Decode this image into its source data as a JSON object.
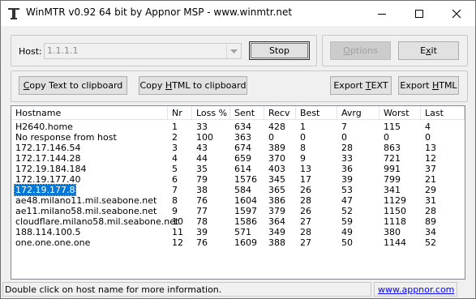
{
  "window": {
    "title": "WinMTR v0.92 64 bit by Appnor MSP - www.winmtr.net"
  },
  "host": {
    "label": "Host:",
    "value": "1.1.1.1"
  },
  "buttons": {
    "stop": "Stop",
    "options": "Options",
    "exit": "Exit",
    "copy_text": "Copy Text to clipboard",
    "copy_html": "Copy HTML to clipboard",
    "export_text": "Export TEXT",
    "export_html": "Export HTML"
  },
  "table": {
    "columns": [
      "Hostname",
      "Nr",
      "Loss %",
      "Sent",
      "Recv",
      "Best",
      "Avrg",
      "Worst",
      "Last"
    ],
    "rows": [
      [
        "H2640.home",
        "1",
        "33",
        "634",
        "428",
        "1",
        "7",
        "115",
        "4"
      ],
      [
        "No response from host",
        "2",
        "100",
        "363",
        "0",
        "0",
        "0",
        "0",
        "0"
      ],
      [
        "172.17.146.54",
        "3",
        "43",
        "674",
        "389",
        "8",
        "28",
        "863",
        "13"
      ],
      [
        "172.17.144.28",
        "4",
        "44",
        "659",
        "370",
        "9",
        "33",
        "721",
        "12"
      ],
      [
        "172.19.184.184",
        "5",
        "35",
        "614",
        "403",
        "13",
        "36",
        "991",
        "37"
      ],
      [
        "172.19.177.40",
        "6",
        "79",
        "1576",
        "345",
        "17",
        "39",
        "799",
        "21"
      ],
      [
        "172.19.177.8",
        "7",
        "38",
        "584",
        "365",
        "26",
        "53",
        "341",
        "29"
      ],
      [
        "ae48.milano11.mil.seabone.net",
        "8",
        "76",
        "1604",
        "386",
        "28",
        "47",
        "1129",
        "31"
      ],
      [
        "ae11.milano58.mil.seabone.net",
        "9",
        "77",
        "1597",
        "379",
        "26",
        "52",
        "1150",
        "28"
      ],
      [
        "cloudflare.milano58.mil.seabone.net",
        "10",
        "78",
        "1586",
        "364",
        "27",
        "59",
        "1118",
        "89"
      ],
      [
        "188.114.100.5",
        "11",
        "39",
        "571",
        "349",
        "28",
        "49",
        "380",
        "34"
      ],
      [
        "one.one.one.one",
        "12",
        "76",
        "1609",
        "388",
        "27",
        "50",
        "1144",
        "52"
      ]
    ],
    "selected_row": 6
  },
  "status": {
    "message": "Double click on host name for more information.",
    "link": "www.appnor.com"
  },
  "colors": {
    "selection": "#0078d7",
    "link": "#0000ff"
  }
}
